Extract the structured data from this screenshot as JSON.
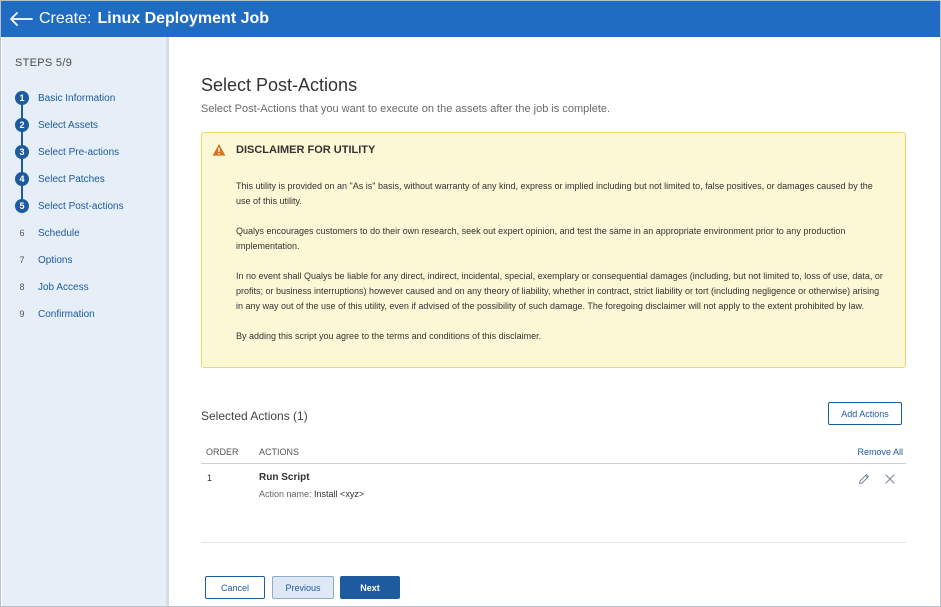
{
  "header": {
    "prefix": "Create:",
    "title": "Linux Deployment Job"
  },
  "sidebar": {
    "steps_label": "STEPS 5/9",
    "steps": [
      {
        "num": "1",
        "label": "Basic Information",
        "state": "done"
      },
      {
        "num": "2",
        "label": "Select Assets",
        "state": "done"
      },
      {
        "num": "3",
        "label": "Select Pre-actions",
        "state": "done"
      },
      {
        "num": "4",
        "label": "Select Patches",
        "state": "done"
      },
      {
        "num": "5",
        "label": "Select Post-actions",
        "state": "current"
      },
      {
        "num": "6",
        "label": "Schedule",
        "state": "todo"
      },
      {
        "num": "7",
        "label": "Options",
        "state": "todo"
      },
      {
        "num": "8",
        "label": "Job Access",
        "state": "todo"
      },
      {
        "num": "9",
        "label": "Confirmation",
        "state": "todo"
      }
    ]
  },
  "main": {
    "title": "Select Post-Actions",
    "subtitle": "Select Post-Actions that you want to execute on the assets after the job is complete.",
    "disclaimer": {
      "title": "DISCLAIMER FOR UTILITY",
      "paragraphs": [
        "This utility is provided on an \"As is\" basis, without warranty of any kind, express or implied including but not limited to, false positives, or damages caused by the use of this utility.",
        "Qualys encourages customers to do their own research, seek out expert opinion, and test the same in an appropriate environment prior to any production implementation.",
        "In no event shall Qualys be liable for any direct, indirect, incidental, special, exemplary or consequential damages (including, but not limited to, loss of use, data, or profits; or business interruptions) however caused and on any theory of liability, whether in contract, strict liability or tort (including negligence or otherwise) arising in any way out of the use of this utility, even if advised of the possibility of such damage. The foregoing disclaimer will not apply to the extent prohibited by law.",
        "By adding this script you agree to the terms and conditions of this disclaimer."
      ]
    },
    "selected_title": "Selected Actions (1)",
    "add_actions_label": "Add Actions",
    "table": {
      "col_order": "ORDER",
      "col_actions": "ACTIONS",
      "remove_all": "Remove All",
      "rows": [
        {
          "order": "1",
          "action": "Run Script",
          "sub_label": "Action name:",
          "sub_value": "Install <xyz>"
        }
      ]
    }
  },
  "footer": {
    "cancel": "Cancel",
    "previous": "Previous",
    "next": "Next"
  },
  "colors": {
    "header_bg": "#1f6cc2",
    "accent": "#1d5b9e",
    "sidebar_bg": "#e6eef7",
    "disclaimer_bg": "#fcf7d5",
    "warning": "#d9701c"
  }
}
